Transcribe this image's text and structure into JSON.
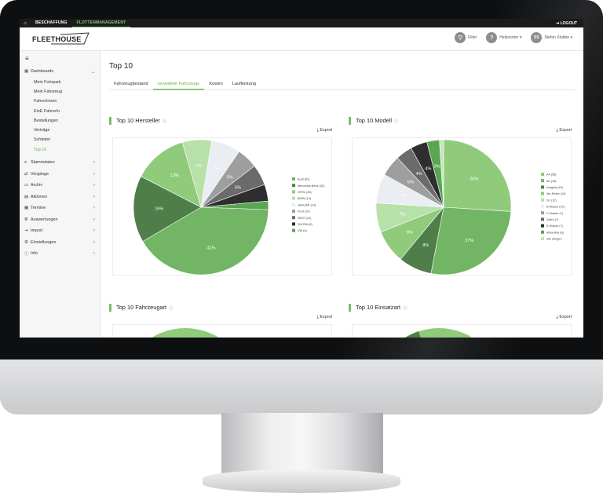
{
  "topbar": {
    "home_icon": "home-icon",
    "tabs": [
      {
        "label": "BESCHAFFUNG",
        "active": false
      },
      {
        "label": "FLOTTENMANAGEMENT",
        "active": true
      }
    ],
    "logout_label": "LOGOUT"
  },
  "header": {
    "logo": "FLEETHOUSE",
    "filter_label": "Filter",
    "help_label": "Helpcenter",
    "user_initials": "SS",
    "user_name": "Stefan Stubbe"
  },
  "sidebar": {
    "dashboards_label": "Dashboards",
    "sub_items": [
      "Mein Fuhrpark",
      "Mein Fahrzeug",
      "FahrerInnen",
      "EinE FahrerIn",
      "Bestellungen",
      "Verträge",
      "Schäden",
      "Top 10"
    ],
    "active_sub": 7,
    "items": [
      {
        "label": "Stammdaten",
        "icon": "database-icon"
      },
      {
        "label": "Vorgänge",
        "icon": "process-icon"
      },
      {
        "label": "Archiv",
        "icon": "archive-icon"
      },
      {
        "label": "Aktionen",
        "icon": "actions-icon"
      },
      {
        "label": "Termine",
        "icon": "calendar-icon"
      },
      {
        "label": "Auswertungen",
        "icon": "chart-icon"
      },
      {
        "label": "Import",
        "icon": "import-icon"
      },
      {
        "label": "Einstellungen",
        "icon": "settings-icon"
      },
      {
        "label": "Info",
        "icon": "info-icon"
      }
    ]
  },
  "main": {
    "title": "Top 10",
    "tabs": [
      "Fahrzeugbestand",
      "verwaltete Fahrzeuge",
      "Kosten",
      "Laufleistung"
    ],
    "active_tab": 1,
    "export_label": "Export",
    "info_icon": "info-icon"
  },
  "chart_data": [
    {
      "type": "pie",
      "title": "Top 10 Hersteller",
      "categories": [
        "Audi (81)",
        "Mercedes-Benz (32)",
        "OPEL (26)",
        "BMW (14)",
        "JAGUAR (14)",
        "Ford (10)",
        "SEAT (10)",
        "SKODA (8)",
        "VW (4)"
      ],
      "values": [
        41,
        16,
        13,
        7,
        7,
        5,
        5,
        4,
        2
      ],
      "labels": [
        "41%",
        "16%",
        "13%",
        "7%",
        "7%",
        "5%",
        "5%",
        "",
        ""
      ],
      "colors": [
        "#72b665",
        "#4f7e4a",
        "#8fcb7b",
        "#b8e1aa",
        "#eaeef2",
        "#9e9e9e",
        "#6b6b6b",
        "#2e2e2e",
        "#5aa552"
      ],
      "legend": "right"
    },
    {
      "type": "pie",
      "title": "Top 10 Modell",
      "categories": [
        "A4 (55)",
        "A6 (15)",
        "Insignia (15)",
        "3er-Reihe (13)",
        "XF (12)",
        "B-Klasse (10)",
        "C-Klasse (7)",
        "Zafira (7)",
        "E-Klasse (7)",
        "Alhambra (6)",
        "alle übrigen"
      ],
      "values": [
        26,
        27,
        8,
        8,
        7,
        7,
        5,
        4,
        4,
        3,
        1
      ],
      "labels": [
        "26%",
        "27%",
        "8%",
        "8%",
        "7%",
        "7%",
        "5%",
        "4%",
        "4%",
        "3%",
        ""
      ],
      "colors": [
        "#8fcb7b",
        "#72b665",
        "#4f7e4a",
        "#8fcb7b",
        "#b8e1aa",
        "#eaeef2",
        "#9e9e9e",
        "#6b6b6b",
        "#2e2e2e",
        "#5aa552",
        "#c7e6bb"
      ],
      "legend": "right"
    },
    {
      "type": "pie",
      "title": "Top 10 Fahrzeugart",
      "categories": [],
      "values": [],
      "legend": "right"
    },
    {
      "type": "pie",
      "title": "Top 10 Einsatzart",
      "categories": [],
      "values": [],
      "legend": "right"
    }
  ]
}
